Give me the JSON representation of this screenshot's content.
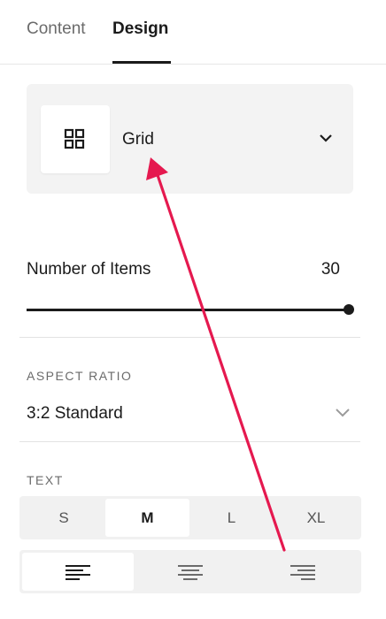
{
  "tabs": [
    {
      "label": "Content",
      "active": false
    },
    {
      "label": "Design",
      "active": true
    }
  ],
  "layout": {
    "selected": "Grid",
    "icon": "grid-icon"
  },
  "number_of_items": {
    "label": "Number of Items",
    "value": "30",
    "slider_fraction": 1.0
  },
  "aspect_ratio": {
    "label": "ASPECT RATIO",
    "value": "3:2 Standard"
  },
  "text": {
    "label": "TEXT",
    "sizes": [
      {
        "label": "S",
        "active": false
      },
      {
        "label": "M",
        "active": true
      },
      {
        "label": "L",
        "active": false
      },
      {
        "label": "XL",
        "active": false
      }
    ],
    "alignments": [
      {
        "name": "align-left",
        "active": true
      },
      {
        "name": "align-center",
        "active": false
      },
      {
        "name": "align-right",
        "active": false
      }
    ]
  },
  "annotation": {
    "arrow_color": "#e5194f"
  }
}
